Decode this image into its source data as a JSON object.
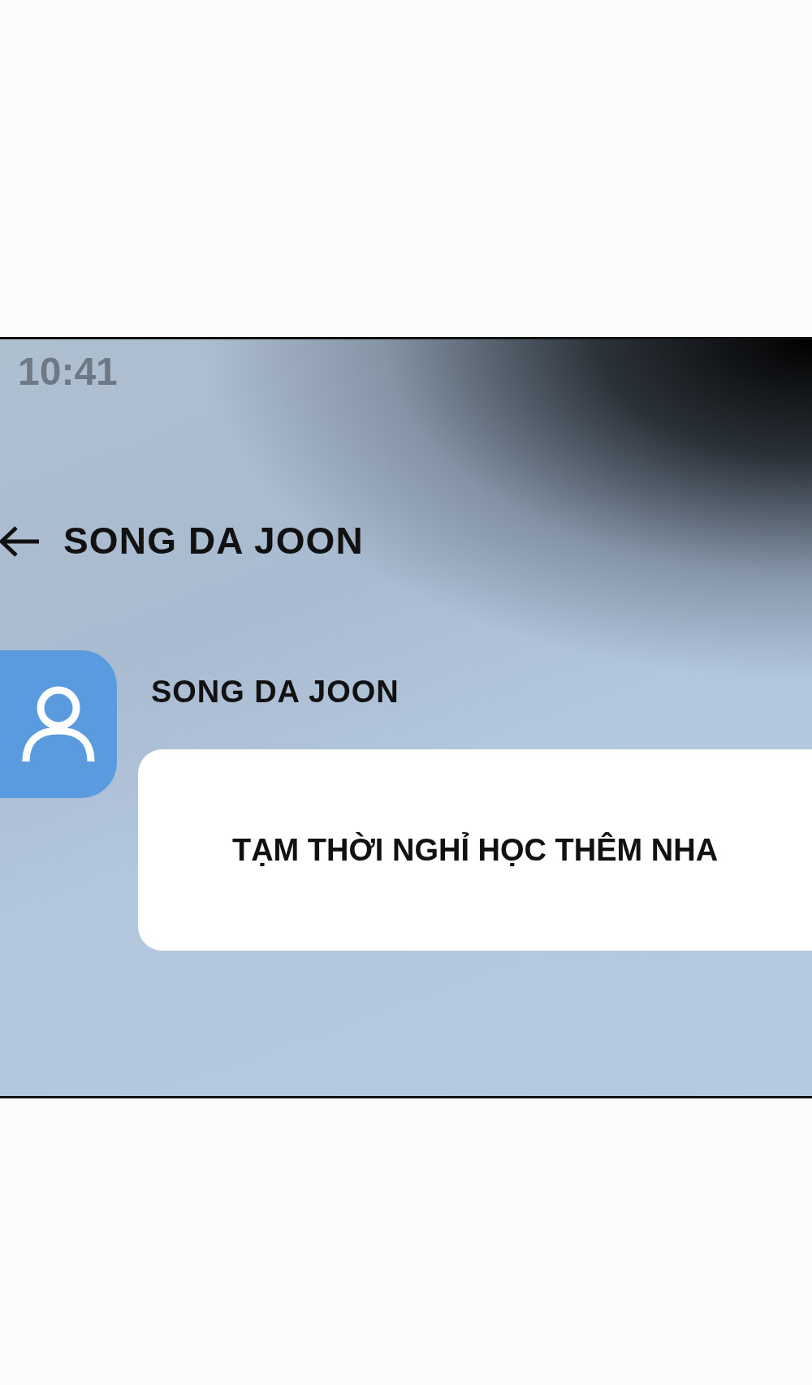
{
  "status_bar": {
    "time": "10:41"
  },
  "header": {
    "title": "SONG DA JOON"
  },
  "messages": [
    {
      "sender": "SONG DA JOON",
      "text": "TẠM THỜI NGHỈ HỌC THÊM NHA"
    }
  ]
}
